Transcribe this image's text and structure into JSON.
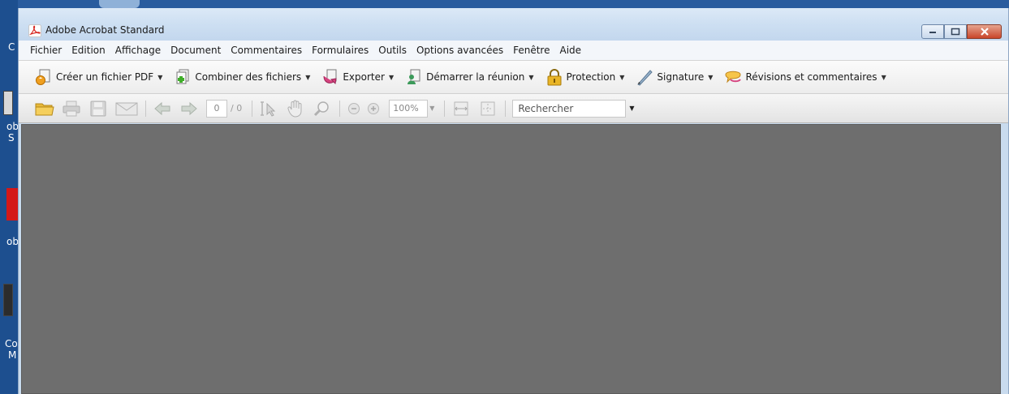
{
  "window": {
    "title": "Adobe Acrobat Standard"
  },
  "menu": {
    "items": [
      "Fichier",
      "Edition",
      "Affichage",
      "Document",
      "Commentaires",
      "Formulaires",
      "Outils",
      "Options avancées",
      "Fenêtre",
      "Aide"
    ]
  },
  "tasks": {
    "create_pdf": "Créer un fichier PDF",
    "combine": "Combiner des fichiers",
    "export": "Exporter",
    "meeting": "Démarrer la réunion",
    "protection": "Protection",
    "signature": "Signature",
    "review": "Révisions et commentaires"
  },
  "tools": {
    "page_current": "0",
    "page_total": "/ 0",
    "zoom": "100%",
    "search_placeholder": "Rechercher"
  },
  "desktop": {
    "labels": [
      "C",
      "ob",
      "S",
      "ob",
      "Co",
      "M"
    ]
  },
  "colors": {
    "document_area": "#6e6e6e",
    "titlebar": "#cddff2",
    "close_button": "#c9452a"
  }
}
